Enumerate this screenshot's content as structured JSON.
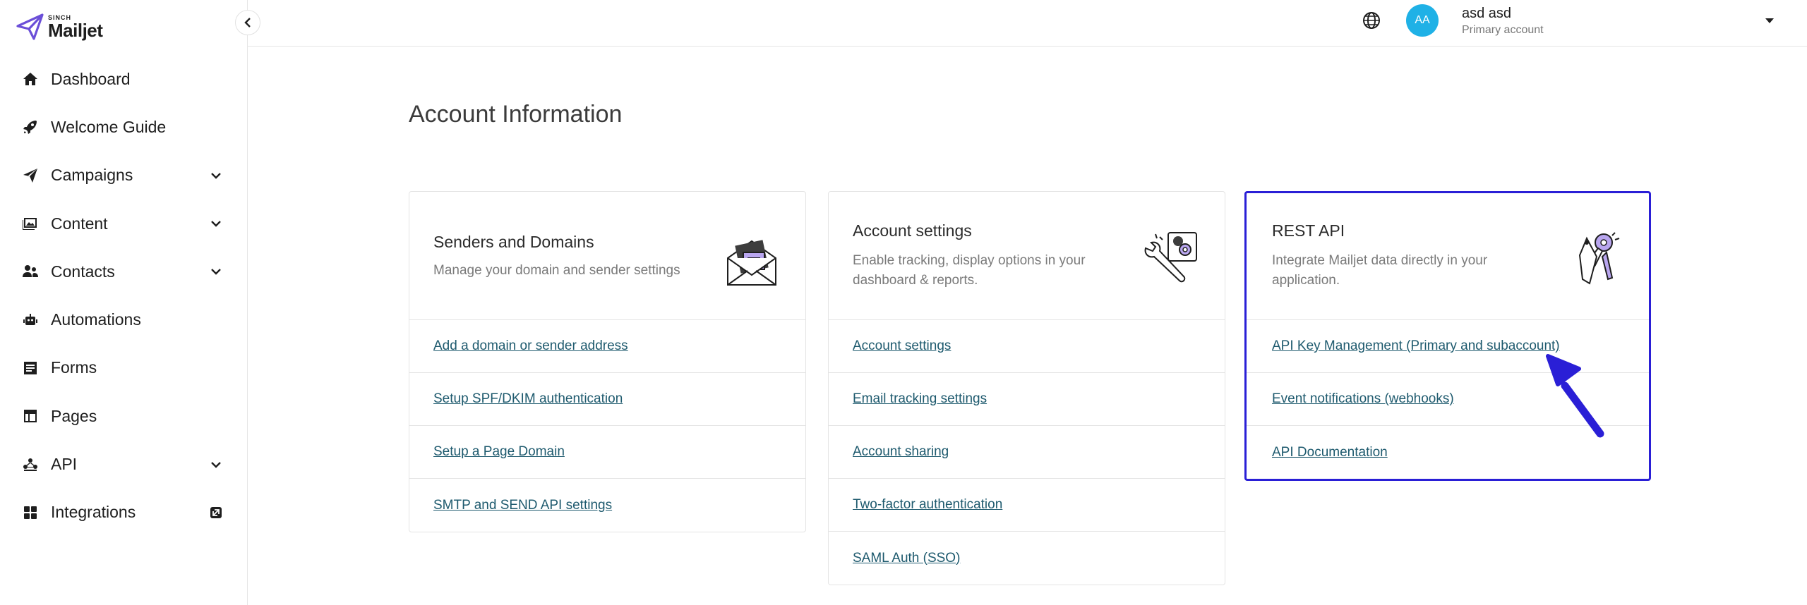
{
  "brand": {
    "sinch": "SINCH",
    "name": "Mailjet"
  },
  "sidebar": {
    "items": [
      {
        "label": "Dashboard",
        "icon": "home-icon",
        "expandable": false
      },
      {
        "label": "Welcome Guide",
        "icon": "rocket-icon",
        "expandable": false
      },
      {
        "label": "Campaigns",
        "icon": "paper-plane-icon",
        "expandable": true
      },
      {
        "label": "Content",
        "icon": "image-icon",
        "expandable": true
      },
      {
        "label": "Contacts",
        "icon": "contacts-icon",
        "expandable": true
      },
      {
        "label": "Automations",
        "icon": "robot-icon",
        "expandable": false
      },
      {
        "label": "Forms",
        "icon": "form-icon",
        "expandable": false
      },
      {
        "label": "Pages",
        "icon": "layout-icon",
        "expandable": false
      },
      {
        "label": "API",
        "icon": "api-icon",
        "expandable": true
      },
      {
        "label": "Integrations",
        "icon": "grid-icon",
        "expandable": false,
        "external": true
      }
    ]
  },
  "header": {
    "avatar_initials": "AA",
    "user_name": "asd asd",
    "account_type": "Primary account"
  },
  "main": {
    "title": "Account Information",
    "cards": [
      {
        "title": "Senders and Domains",
        "description": "Manage your domain and sender settings",
        "illustration": "envelope-illustration-icon",
        "links": [
          "Add a domain or sender address",
          "Setup SPF/DKIM authentication",
          "Setup a Page Domain",
          "SMTP and SEND API settings"
        ]
      },
      {
        "title": "Account settings",
        "description": "Enable tracking, display options in your dashboard & reports.",
        "illustration": "settings-tools-illustration-icon",
        "links": [
          "Account settings",
          "Email tracking settings",
          "Account sharing",
          "Two-factor authentication",
          "SAML Auth (SSO)"
        ]
      },
      {
        "title": "REST API",
        "description": "Integrate Mailjet data directly in your application.",
        "illustration": "api-keys-illustration-icon",
        "links": [
          "API Key Management (Primary and subaccount)",
          "Event notifications (webhooks)",
          "API Documentation"
        ]
      }
    ]
  },
  "colors": {
    "highlight_border": "#2a1fd6",
    "arrow": "#2a1fd6",
    "avatar": "#1fb1e6",
    "link": "#1e5a6e",
    "brand_purple": "#6b4fd8"
  }
}
